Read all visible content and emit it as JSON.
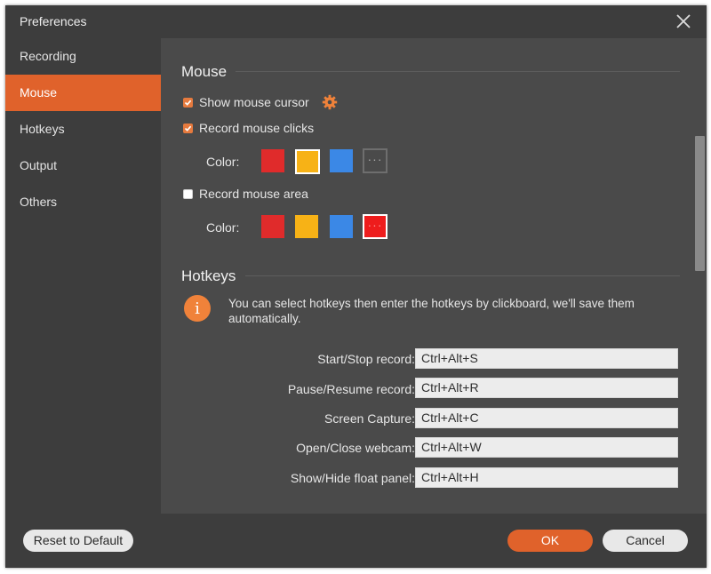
{
  "window": {
    "title": "Preferences"
  },
  "sidebar": {
    "items": [
      {
        "label": "Recording",
        "active": false
      },
      {
        "label": "Mouse",
        "active": true
      },
      {
        "label": "Hotkeys",
        "active": false
      },
      {
        "label": "Output",
        "active": false
      },
      {
        "label": "Others",
        "active": false
      }
    ]
  },
  "mouse": {
    "heading": "Mouse",
    "show_cursor": {
      "label": "Show mouse cursor",
      "checked": true
    },
    "record_clicks": {
      "label": "Record mouse clicks",
      "checked": true
    },
    "clicks_color_label": "Color:",
    "record_area": {
      "label": "Record mouse area",
      "checked": false
    },
    "area_color_label": "Color:",
    "more_label": "···",
    "colors": {
      "red": "#e02b2b",
      "yellow": "#f7b216",
      "blue": "#3b88e6",
      "custom_red": "#ee1c1c"
    }
  },
  "hotkeys": {
    "heading": "Hotkeys",
    "info": "You can select hotkeys then enter the hotkeys by clickboard, we'll save them automatically.",
    "rows": [
      {
        "label": "Start/Stop record:",
        "value": "Ctrl+Alt+S"
      },
      {
        "label": "Pause/Resume record:",
        "value": "Ctrl+Alt+R"
      },
      {
        "label": "Screen Capture:",
        "value": "Ctrl+Alt+C"
      },
      {
        "label": "Open/Close webcam:",
        "value": "Ctrl+Alt+W"
      },
      {
        "label": "Show/Hide float panel:",
        "value": "Ctrl+Alt+H"
      }
    ]
  },
  "footer": {
    "reset_label": "Reset to Default",
    "ok_label": "OK",
    "cancel_label": "Cancel"
  },
  "theme": {
    "accent": "#e0622b",
    "panel": "#3d3d3d",
    "content": "#4a4a4a"
  }
}
